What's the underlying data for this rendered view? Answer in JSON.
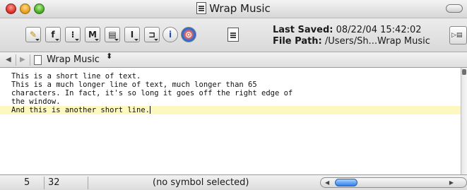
{
  "window": {
    "title": "Wrap Music"
  },
  "toolbar": {
    "buttons": [
      {
        "name": "text-options",
        "glyph": "✎"
      },
      {
        "name": "functions",
        "glyph": "f"
      },
      {
        "name": "markers",
        "glyph": "⁝"
      },
      {
        "name": "macros",
        "glyph": "M"
      },
      {
        "name": "documents",
        "glyph": "▤"
      },
      {
        "name": "text-cursor",
        "glyph": "I"
      },
      {
        "name": "folder",
        "glyph": "⊐"
      },
      {
        "name": "info",
        "glyph": "i"
      },
      {
        "name": "browser-preview",
        "glyph": "⊙"
      }
    ],
    "last_saved_label": "Last Saved:",
    "last_saved_value": "08/22/04 15:42:02",
    "file_path_label": "File Path:",
    "file_path_value": "/Users/Sh...Wrap Music"
  },
  "navbar": {
    "back": "◀",
    "forward": "▶",
    "document_title": "Wrap Music",
    "updown": "⬍"
  },
  "editor": {
    "lines": [
      "This is a short line of text.",
      "This is a much longer line of text, much longer than 65",
      "characters. In fact, it's so long it goes off the right edge of",
      "the window.",
      "And this is another short line."
    ],
    "current_line_index": 4
  },
  "statusbar": {
    "line_number": "5",
    "column_number": "32",
    "symbol_status": "(no symbol selected)"
  },
  "colors": {
    "current_line_highlight": "#fdf7c0",
    "scroll_knob": "#2f7ee8"
  }
}
